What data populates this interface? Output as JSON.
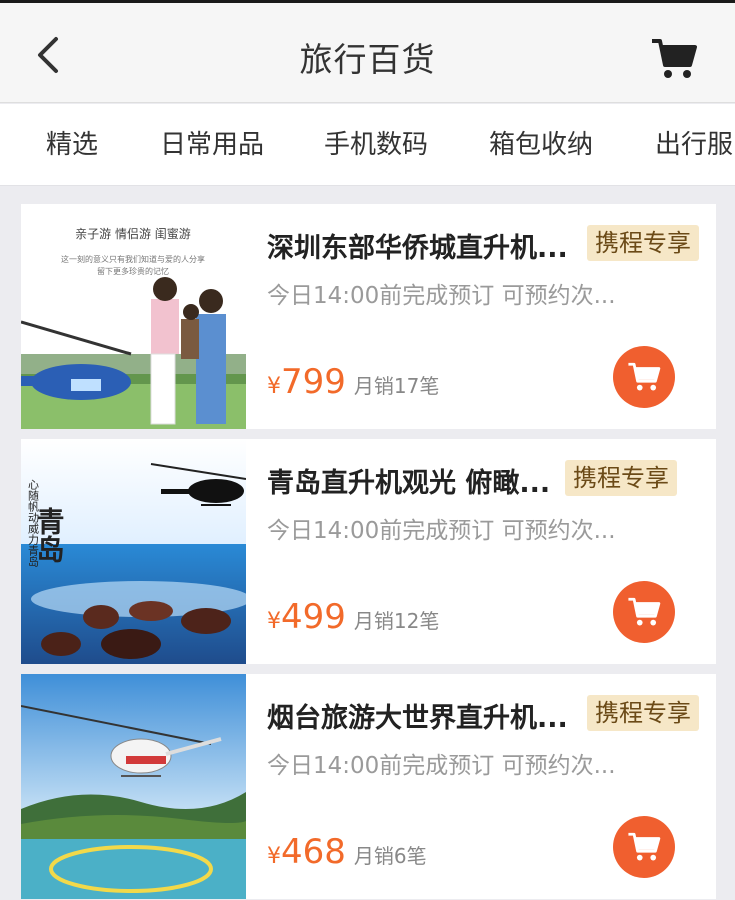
{
  "header": {
    "title": "旅行百货",
    "back_icon": "back-chevron-icon",
    "cart_icon": "cart-icon"
  },
  "tabs": [
    {
      "label": "精选"
    },
    {
      "label": "日常用品"
    },
    {
      "label": "手机数码"
    },
    {
      "label": "箱包收纳"
    },
    {
      "label": "出行服"
    }
  ],
  "products": [
    {
      "name": "深圳东部华侨城直升机...",
      "tag": "携程专享",
      "desc": "今日14:00前完成预订 可预约次...",
      "currency": "¥",
      "price": "799",
      "sales": "月销17笔",
      "image_text": {
        "line1": "亲子游  情侣游  闺蜜游",
        "line2": "这一刻的意义只有我们知道与爱的人分享",
        "line3": "留下更多珍贵的记忆"
      }
    },
    {
      "name": "青岛直升机观光 俯瞰...",
      "tag": "携程专享",
      "desc": "今日14:00前完成预订 可预约次...",
      "currency": "¥",
      "price": "499",
      "sales": "月销12笔",
      "image_text": {
        "big": "青岛",
        "vertical": "心随帆动威力青岛"
      }
    },
    {
      "name": "烟台旅游大世界直升机...",
      "tag": "携程专享",
      "desc": "今日14:00前完成预订 可预约次...",
      "currency": "¥",
      "price": "468",
      "sales": "月销6笔"
    }
  ],
  "colors": {
    "accent": "#f05f2f",
    "price": "#f26a2a",
    "tag_bg": "#f6e7c7"
  }
}
